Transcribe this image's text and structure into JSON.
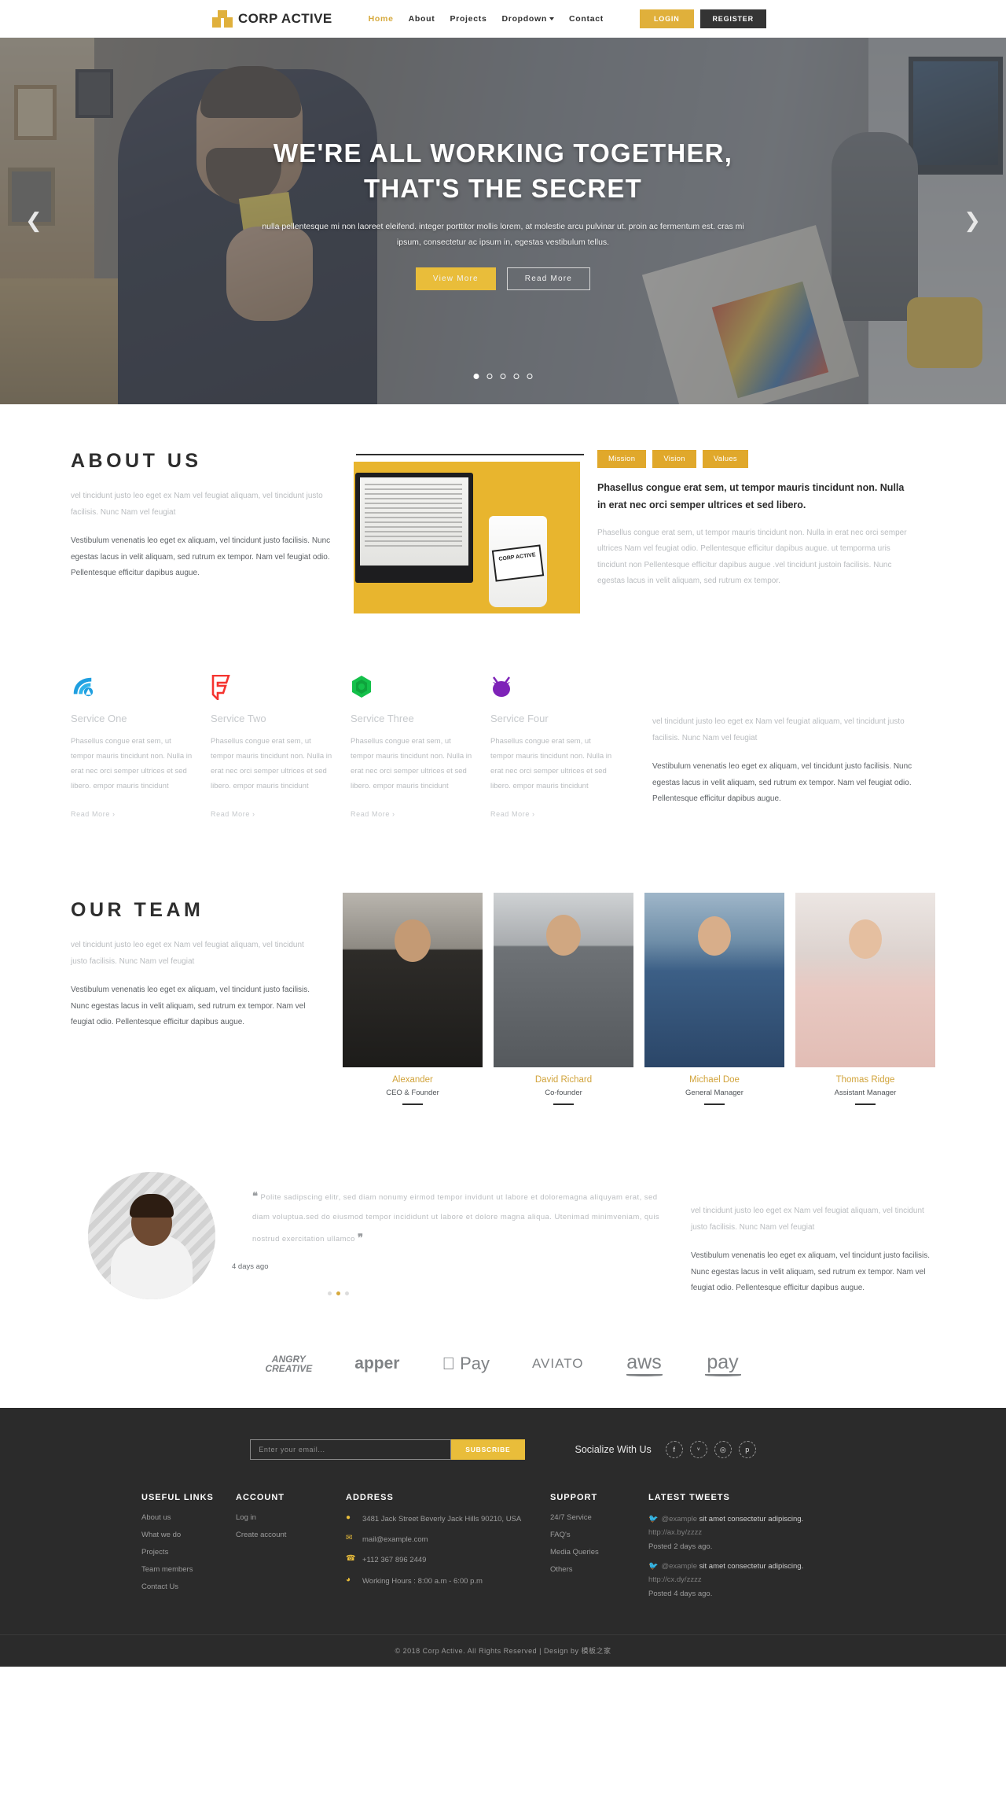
{
  "header": {
    "brand": "CORP ACTIVE",
    "nav": [
      {
        "label": "Home",
        "active": true
      },
      {
        "label": "About",
        "active": false
      },
      {
        "label": "Projects",
        "active": false
      },
      {
        "label": "Dropdown",
        "active": false,
        "caret": true
      },
      {
        "label": "Contact",
        "active": false
      }
    ],
    "login_label": "LOGIN",
    "register_label": "REGISTER",
    "accent": "#e0b03b"
  },
  "hero": {
    "title_line1": "WE'RE ALL WORKING TOGETHER,",
    "title_line2": "THAT'S THE SECRET",
    "subtitle": "nulla pellentesque mi non laoreet eleifend. integer porttitor mollis lorem, at molestie arcu pulvinar ut. proin ac fermentum est. cras mi ipsum, consectetur ac ipsum in, egestas vestibulum tellus.",
    "btn_primary": "View More",
    "btn_secondary": "Read More",
    "prev_icon": "chevron-left",
    "next_icon": "chevron-right",
    "slides": 5,
    "active_slide": 1
  },
  "about": {
    "title": "ABOUT US",
    "muted": "vel tincidunt justo leo eget ex Nam vel feugiat aliquam, vel tincidunt justo facilisis. Nunc Nam vel feugiat",
    "body": "Vestibulum venenatis leo eget ex aliquam, vel tincidunt justo facilisis. Nunc egestas lacus in velit aliquam, sed rutrum ex tempor. Nam vel feugiat odio. Pellentesque efficitur dapibus augue.",
    "cup_label": "CORP ACTIVE",
    "tabs": [
      "Mission",
      "Vision",
      "Values"
    ],
    "lead": "Phasellus congue erat sem, ut tempor mauris tincidunt non. Nulla in erat nec orci semper ultrices et sed libero.",
    "paragraph": "Phasellus congue erat sem, ut tempor mauris tincidunt non. Nulla in erat nec orci semper ultrices Nam vel feugiat odio. Pellentesque efficitur dapibus augue. ut temporma uris tincidunt non Pellentesque efficitur dapibus augue .vel tincidunt justoin facilisis. Nunc egestas lacus in velit aliquam, sed rutrum ex tempor."
  },
  "services": {
    "items": [
      {
        "icon": "signal-icon",
        "title": "Service One",
        "text": "Phasellus congue erat sem, ut tempor mauris tincidunt non. Nulla in erat nec orci semper ultrices et sed libero. empor mauris tincidunt",
        "more": "Read More ›",
        "color": "#1f9fe0"
      },
      {
        "icon": "foursquare-icon",
        "title": "Service Two",
        "text": "Phasellus congue erat sem, ut tempor mauris tincidunt non. Nulla in erat nec orci semper ultrices et sed libero. empor mauris tincidunt",
        "more": "Read More ›",
        "color": "#f5342f"
      },
      {
        "icon": "hexagon-icon",
        "title": "Service Three",
        "text": "Phasellus congue erat sem, ut tempor mauris tincidunt non. Nulla in erat nec orci semper ultrices et sed libero. empor mauris tincidunt",
        "more": "Read More ›",
        "color": "#14c04a"
      },
      {
        "icon": "mask-icon",
        "title": "Service Four",
        "text": "Phasellus congue erat sem, ut tempor mauris tincidunt non. Nulla in erat nec orci semper ultrices et sed libero. empor mauris tincidunt",
        "more": "Read More ›",
        "color": "#7e23b8"
      }
    ],
    "side_muted": "vel tincidunt justo leo eget ex Nam vel feugiat aliquam, vel tincidunt justo facilisis. Nunc Nam vel feugiat",
    "side_body": "Vestibulum venenatis leo eget ex aliquam, vel tincidunt justo facilisis. Nunc egestas lacus in velit aliquam, sed rutrum ex tempor. Nam vel feugiat odio. Pellentesque efficitur dapibus augue."
  },
  "team": {
    "title": "OUR TEAM",
    "muted": "vel tincidunt justo leo eget ex Nam vel feugiat aliquam, vel tincidunt justo facilisis. Nunc Nam vel feugiat",
    "body": "Vestibulum venenatis leo eget ex aliquam, vel tincidunt justo facilisis. Nunc egestas lacus in velit aliquam, sed rutrum ex tempor. Nam vel feugiat odio. Pellentesque efficitur dapibus augue.",
    "members": [
      {
        "name": "Alexander",
        "role": "CEO & Founder"
      },
      {
        "name": "David Richard",
        "role": "Co-founder"
      },
      {
        "name": "Michael Doe",
        "role": "General Manager"
      },
      {
        "name": "Thomas Ridge",
        "role": "Assistant Manager"
      }
    ]
  },
  "testimonial": {
    "quote": "Polite sadipscing elitr, sed diam nonumy eirmod tempor invidunt ut labore et doloremagna aliquyam erat, sed diam voluptua.sed do eiusmod tempor incididunt ut labore et dolore magna aliqua. Utenimad minimveniam, quis nostrud exercitation ullamco",
    "date": "4 days ago",
    "open_quote": "❝",
    "close_quote": "❞",
    "side_muted": "vel tincidunt justo leo eget ex Nam vel feugiat aliquam, vel tincidunt justo facilisis. Nunc Nam vel feugiat",
    "side_body": "Vestibulum venenatis leo eget ex aliquam, vel tincidunt justo facilisis. Nunc egestas lacus in velit aliquam, sed rutrum ex tempor. Nam vel feugiat odio. Pellentesque efficitur dapibus augue.",
    "dots": 3,
    "active_dot": 2
  },
  "brands": [
    {
      "name": "ANGRY CREATIVE",
      "line1": "ANGRY",
      "line2": "CREATIVE"
    },
    {
      "name": "apper",
      "line1": "apper"
    },
    {
      "name": "Apple Pay",
      "line1": " Pay"
    },
    {
      "name": "AVIATO",
      "line1": "AVIATO"
    },
    {
      "name": "aws",
      "line1": "aws"
    },
    {
      "name": "amazon pay",
      "line1": "pay"
    }
  ],
  "footer": {
    "newsletter_placeholder": "Enter your email...",
    "newsletter_value": "",
    "subscribe_label": "SUBSCRIBE",
    "social_label": "Socialize With Us",
    "social": [
      {
        "icon": "facebook-icon",
        "glyph": "f"
      },
      {
        "icon": "twitter-icon",
        "glyph": "ᵛ"
      },
      {
        "icon": "instagram-icon",
        "glyph": "◎"
      },
      {
        "icon": "pinterest-icon",
        "glyph": "p"
      }
    ],
    "useful": {
      "title": "USEFUL LINKS",
      "items": [
        "About us",
        "What we do",
        "Projects",
        "Team members",
        "Contact Us"
      ]
    },
    "account": {
      "title": "ACCOUNT",
      "items": [
        "Log in",
        "Create account"
      ]
    },
    "address": {
      "title": "ADDRESS",
      "items": [
        {
          "icon": "location-pin-icon",
          "glyph": "⬤",
          "text": "3481 Jack Street Beverly Jack Hills 90210, USA"
        },
        {
          "icon": "envelope-icon",
          "glyph": "✉",
          "text": "mail@example.com"
        },
        {
          "icon": "phone-icon",
          "glyph": "☎",
          "text": "+112 367 896 2449"
        },
        {
          "icon": "clock-icon",
          "glyph": "◔",
          "text": "Working Hours : 8:00 a.m - 6:00 p.m"
        }
      ]
    },
    "support": {
      "title": "SUPPORT",
      "items": [
        "24/7 Service",
        "FAQ's",
        "Media Queries",
        "Others"
      ]
    },
    "tweets": {
      "title": "LATEST TWEETS",
      "items": [
        {
          "handle": "@example",
          "text": "sit amet consectetur adipiscing.",
          "url": "http://ax.by/zzzz",
          "date": "Posted 2 days ago."
        },
        {
          "handle": "@example",
          "text": "sit amet consectetur adipiscing.",
          "url": "http://cx.dy/zzzz",
          "date": "Posted 4 days ago."
        }
      ]
    },
    "copyright": "© 2018 Corp Active. All Rights Reserved | Design by 模板之家"
  }
}
